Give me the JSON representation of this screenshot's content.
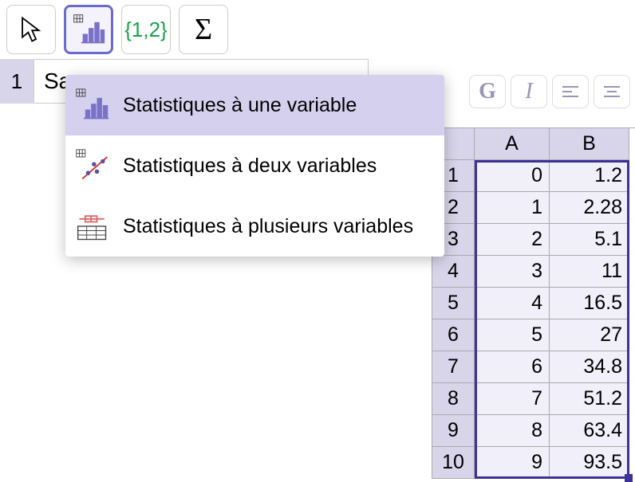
{
  "toolbar": {
    "curly_label": "{1,2}",
    "sigma_label": "Σ"
  },
  "input": {
    "index": "1",
    "value": "Sa"
  },
  "fmt": {
    "bold": "G",
    "italic": "I"
  },
  "dropdown": {
    "items": [
      {
        "label": "Statistiques à une variable"
      },
      {
        "label": "Statistiques à deux variables"
      },
      {
        "label": "Statistiques à plusieurs variables"
      }
    ]
  },
  "sheet": {
    "columns": [
      "A",
      "B"
    ],
    "rows": [
      {
        "head": "1",
        "a": "0",
        "b": "1.2"
      },
      {
        "head": "2",
        "a": "1",
        "b": "2.28"
      },
      {
        "head": "3",
        "a": "2",
        "b": "5.1"
      },
      {
        "head": "4",
        "a": "3",
        "b": "11"
      },
      {
        "head": "5",
        "a": "4",
        "b": "16.5"
      },
      {
        "head": "6",
        "a": "5",
        "b": "27"
      },
      {
        "head": "7",
        "a": "6",
        "b": "34.8"
      },
      {
        "head": "8",
        "a": "7",
        "b": "51.2"
      },
      {
        "head": "9",
        "a": "8",
        "b": "63.4"
      },
      {
        "head": "10",
        "a": "9",
        "b": "93.5"
      }
    ]
  }
}
